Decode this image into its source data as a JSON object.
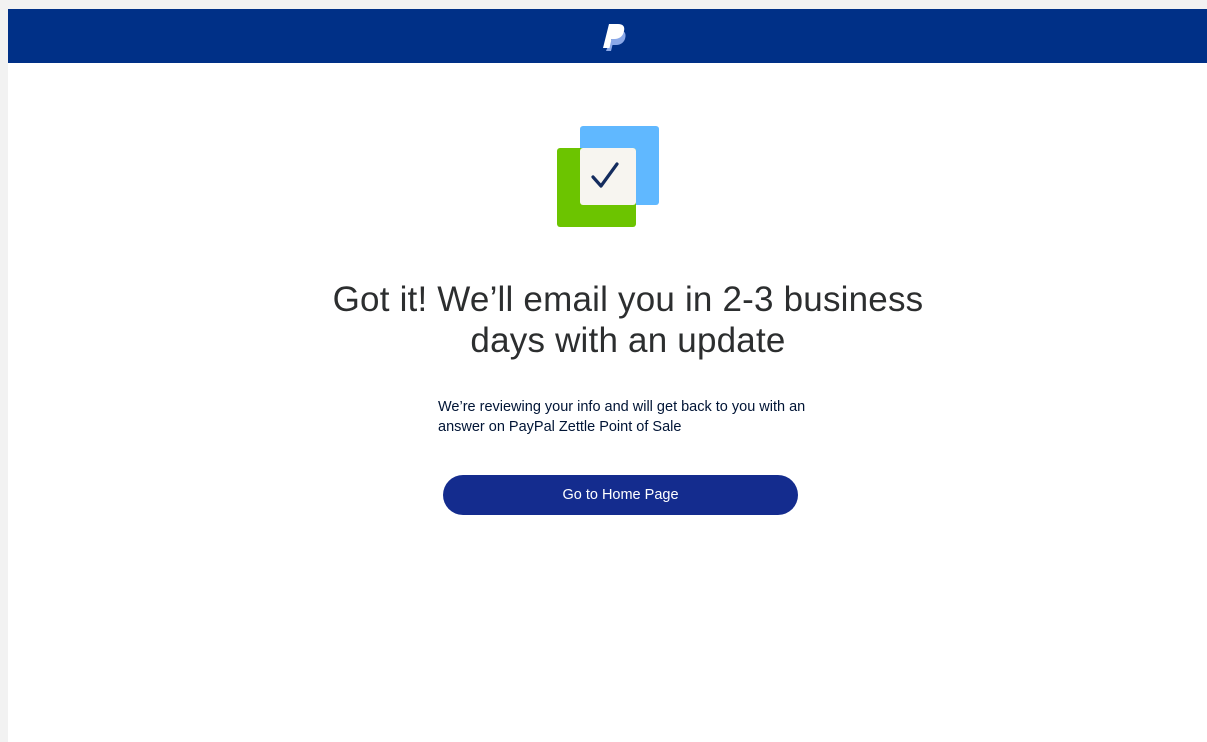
{
  "header": {
    "logo_icon": "paypal-logo-icon",
    "background_color": "#003087"
  },
  "illustration": {
    "icon": "checkmark-document-icon",
    "colors": {
      "front_square": "#6cc400",
      "back_square": "#60b8ff",
      "paper": "#f7f5f0",
      "check": "#142c5e"
    }
  },
  "main": {
    "headline": "Got it! We’ll email you in 2-3 business days with an update",
    "subtext": "We’re reviewing your info and will get back to you with an answer on PayPal Zettle Point of Sale",
    "button_label": "Go to Home Page",
    "button_color": "#142c8e"
  }
}
